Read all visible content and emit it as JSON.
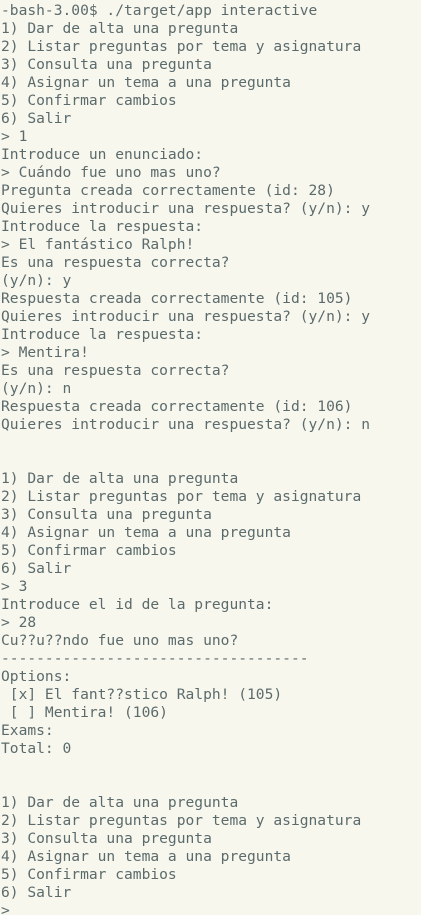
{
  "terminal": {
    "lines": [
      "-bash-3.00$ ./target/app interactive",
      "1) Dar de alta una pregunta",
      "2) Listar preguntas por tema y asignatura",
      "3) Consulta una pregunta",
      "4) Asignar un tema a una pregunta",
      "5) Confirmar cambios",
      "6) Salir",
      "> 1",
      "Introduce un enunciado:",
      "> Cuándo fue uno mas uno?",
      "Pregunta creada correctamente (id: 28)",
      "Quieres introducir una respuesta? (y/n): y",
      "Introduce la respuesta:",
      "> El fantástico Ralph!",
      "Es una respuesta correcta?",
      "(y/n): y",
      "Respuesta creada correctamente (id: 105)",
      "Quieres introducir una respuesta? (y/n): y",
      "Introduce la respuesta:",
      "> Mentira!",
      "Es una respuesta correcta?",
      "(y/n): n",
      "Respuesta creada correctamente (id: 106)",
      "Quieres introducir una respuesta? (y/n): n",
      "",
      "",
      "1) Dar de alta una pregunta",
      "2) Listar preguntas por tema y asignatura",
      "3) Consulta una pregunta",
      "4) Asignar un tema a una pregunta",
      "5) Confirmar cambios",
      "6) Salir",
      "> 3",
      "Introduce el id de la pregunta:",
      "> 28",
      "Cu??u??ndo fue uno mas uno?",
      "-----------------------------------",
      "Options:",
      " [x] El fant??stico Ralph! (105)",
      " [ ] Mentira! (106)",
      "Exams:",
      "Total: 0",
      "",
      "",
      "1) Dar de alta una pregunta",
      "2) Listar preguntas por tema y asignatura",
      "3) Consulta una pregunta",
      "4) Asignar un tema a una pregunta",
      "5) Confirmar cambios",
      "6) Salir",
      ">"
    ]
  },
  "colors": {
    "background": "#f8f7ee",
    "text": "#5b6b6c"
  }
}
